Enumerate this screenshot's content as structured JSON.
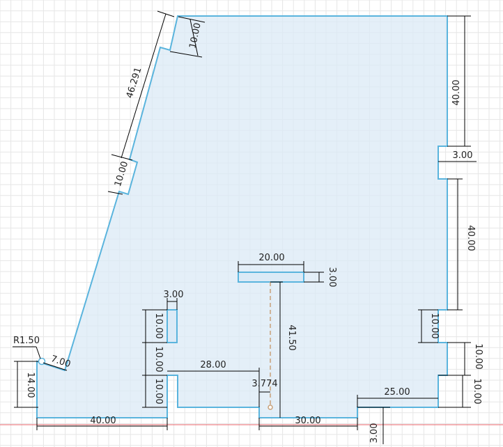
{
  "dimensions": {
    "top_notch": "10.00",
    "slant_long": "46.291",
    "slant_notch": "10.00",
    "right_top": "40.00",
    "right_notch_depth": "3.00",
    "right_mid": "40.00",
    "right_notch2": "10.00",
    "right_low1": "10.00",
    "right_low2": "10.00",
    "slot_width": "20.00",
    "slot_height": "3.00",
    "hole_height": "41.50",
    "left_slot_width": "3.00",
    "left_stack_1": "10.00",
    "left_stack_2": "10.00",
    "left_stack_3": "10.00",
    "offset_28": "28.00",
    "offset_3774": "3.774",
    "radius": "R1.50",
    "radius_dist": "7.00",
    "left_height": "14.00",
    "bottom_left": "40.00",
    "bottom_mid": "30.00",
    "bottom_right": "25.00",
    "bottom_notch_depth": "3.00"
  }
}
